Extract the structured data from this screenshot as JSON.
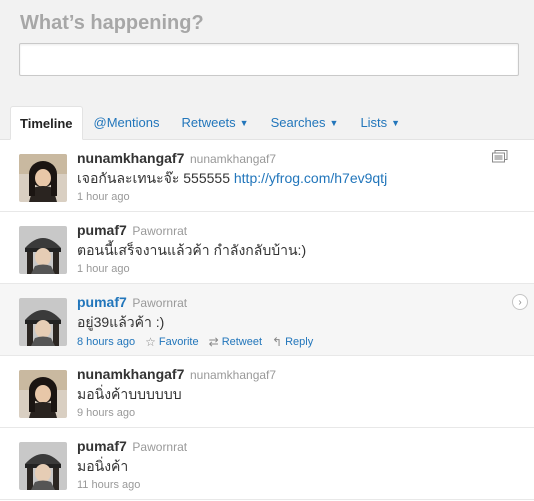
{
  "compose": {
    "prompt": "What’s happening?",
    "value": ""
  },
  "tabs": [
    {
      "label": "Timeline",
      "active": true,
      "dropdown": false
    },
    {
      "label": "@Mentions",
      "active": false,
      "dropdown": false
    },
    {
      "label": "Retweets",
      "active": false,
      "dropdown": true
    },
    {
      "label": "Searches",
      "active": false,
      "dropdown": true
    },
    {
      "label": "Lists",
      "active": false,
      "dropdown": true
    }
  ],
  "tweets": [
    {
      "screen_name": "nunamkhangaf7",
      "full_name": "nunamkhangaf7",
      "text": "เจอกันละเทนะจ๊ะ 555555 ",
      "link": "http://yfrog.com/h7ev9qtj",
      "time": "1 hour ago",
      "avatar": "dark-hair"
    },
    {
      "screen_name": "pumaf7",
      "full_name": "Pawornrat",
      "text": "ตอนนี้เสร็จงานแล้วค้า กำลังกลับบ้าน:)",
      "time": "1 hour ago",
      "avatar": "cap"
    },
    {
      "screen_name": "pumaf7",
      "full_name": "Pawornrat",
      "text": "อยู่39แล้วค้า :)",
      "time": "8 hours ago",
      "avatar": "cap",
      "actions": {
        "favorite": "Favorite",
        "retweet": "Retweet",
        "reply": "Reply"
      }
    },
    {
      "screen_name": "nunamkhangaf7",
      "full_name": "nunamkhangaf7",
      "text": "มอนิ่งค้าบบบบบบ",
      "time": "9 hours ago",
      "avatar": "dark-hair"
    },
    {
      "screen_name": "pumaf7",
      "full_name": "Pawornrat",
      "text": "มอนิ่งค้า",
      "time": "11 hours ago",
      "avatar": "cap"
    }
  ],
  "colors": {
    "link": "#2276bb",
    "muted": "#999999",
    "top_bg": "#f2f2f2"
  }
}
